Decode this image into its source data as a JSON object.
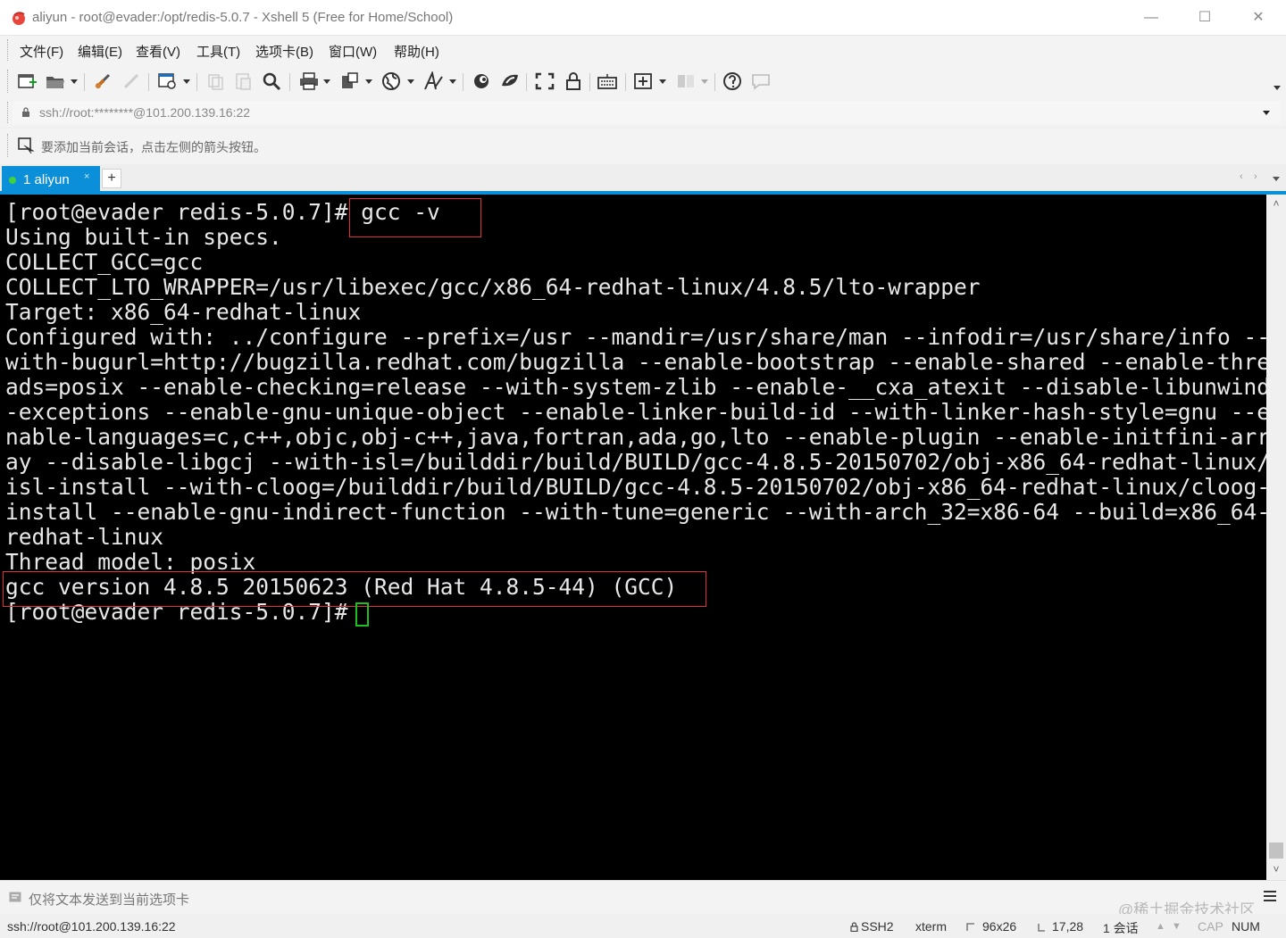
{
  "window": {
    "title": "aliyun - root@evader:/opt/redis-5.0.7 - Xshell 5 (Free for Home/School)",
    "minimize_glyph": "—",
    "maximize_glyph": "☐",
    "close_glyph": "✕"
  },
  "menu": {
    "items": [
      "文件(F)",
      "编辑(E)",
      "查看(V)",
      "工具(T)",
      "选项卡(B)",
      "窗口(W)",
      "帮助(H)"
    ]
  },
  "toolbar": {
    "icons": [
      "new-session-icon",
      "open-folder-icon",
      "reconnect-icon",
      "disconnect-icon",
      "properties-icon",
      "copy-icon",
      "paste-icon",
      "find-icon",
      "print-icon",
      "transfer-icon",
      "globe-icon",
      "font-icon",
      "xftp-icon",
      "tunnel-icon",
      "fullscreen-icon",
      "lock-icon",
      "keyboard-icon",
      "add-icon",
      "layout-icon",
      "help-icon",
      "chat-icon"
    ]
  },
  "address_bar": {
    "value": "ssh://root:********@101.200.139.16:22"
  },
  "session_bar": {
    "hint": "要添加当前会话，点击左侧的箭头按钮。"
  },
  "tabs": {
    "items": [
      {
        "label": "1 aliyun",
        "active": true
      }
    ],
    "close_glyph": "×",
    "add_glyph": "+",
    "prev_glyph": "‹",
    "next_glyph": "›"
  },
  "terminal": {
    "lines": [
      "[root@evader redis-5.0.7]# gcc -v",
      "Using built-in specs.",
      "COLLECT_GCC=gcc",
      "COLLECT_LTO_WRAPPER=/usr/libexec/gcc/x86_64-redhat-linux/4.8.5/lto-wrapper",
      "Target: x86_64-redhat-linux",
      "Configured with: ../configure --prefix=/usr --mandir=/usr/share/man --infodir=/usr/share/info --",
      "with-bugurl=http://bugzilla.redhat.com/bugzilla --enable-bootstrap --enable-shared --enable-thre",
      "ads=posix --enable-checking=release --with-system-zlib --enable-__cxa_atexit --disable-libunwind",
      "-exceptions --enable-gnu-unique-object --enable-linker-build-id --with-linker-hash-style=gnu --e",
      "nable-languages=c,c++,objc,obj-c++,java,fortran,ada,go,lto --enable-plugin --enable-initfini-arr",
      "ay --disable-libgcj --with-isl=/builddir/build/BUILD/gcc-4.8.5-20150702/obj-x86_64-redhat-linux/",
      "isl-install --with-cloog=/builddir/build/BUILD/gcc-4.8.5-20150702/obj-x86_64-redhat-linux/cloog-",
      "install --enable-gnu-indirect-function --with-tune=generic --with-arch_32=x86-64 --build=x86_64-",
      "redhat-linux",
      "Thread model: posix",
      "gcc version 4.8.5 20150623 (Red Hat 4.8.5-44) (GCC)",
      "[root@evader redis-5.0.7]# "
    ],
    "colors": {
      "background": "#000000",
      "text": "#e8e8e8",
      "highlight": "#e0303a",
      "cursor": "#1ec01e"
    }
  },
  "compose_bar": {
    "text": "仅将文本发送到当前选项卡",
    "watermark": "@稀土掘金技术社区"
  },
  "status_bar": {
    "connection": "ssh://root@101.200.139.16:22",
    "protocol": "SSH2",
    "term": "xterm",
    "size": "96x26",
    "position": "17,28",
    "sessions": "1 会话",
    "cap": "CAP",
    "num": "NUM"
  },
  "colors": {
    "accent": "#0a8fd8"
  }
}
